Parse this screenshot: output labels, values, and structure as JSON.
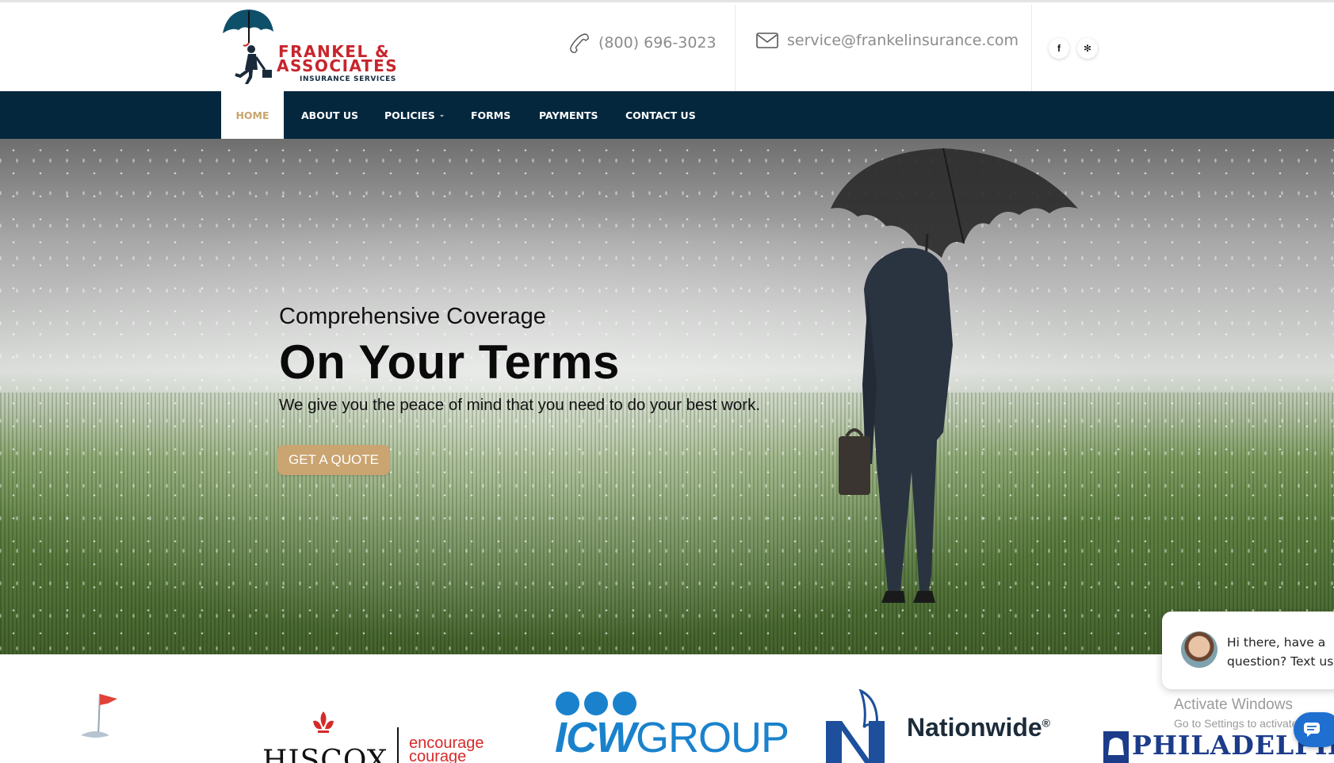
{
  "brand": {
    "name_line1": "FRANKEL &",
    "name_line2": "ASSOCIATES",
    "tagline": "INSURANCE SERVICES"
  },
  "header": {
    "phone": "(800) 696-3023",
    "email": "service@frankelinsurance.com",
    "social": {
      "facebook_glyph": "f",
      "yelp_glyph": "✻"
    }
  },
  "nav": {
    "items": [
      {
        "label": "HOME",
        "active": true
      },
      {
        "label": "ABOUT US"
      },
      {
        "label": "POLICIES",
        "caret": "⌄"
      },
      {
        "label": "FORMS"
      },
      {
        "label": "PAYMENTS"
      },
      {
        "label": "CONTACT US"
      }
    ]
  },
  "hero": {
    "subtitle": "Comprehensive Coverage",
    "title": "On Your Terms",
    "description": "We give you the peace of mind that you need to do your best work.",
    "cta_label": "GET A QUOTE"
  },
  "partners": {
    "hiscox": "HISCOX",
    "hiscox_tag1": "encourage",
    "hiscox_tag2": "courage",
    "icw_bold": "ICW",
    "icw_rest": "GROUP",
    "nationwide": "Nationwide",
    "nationwide_mark": "®",
    "philadelphia": "PHILADELPHIA"
  },
  "chat": {
    "message": "Hi there, have a question? Text us"
  },
  "os_overlay": {
    "line1": "Activate Windows",
    "line2": "Go to Settings to activate Windows."
  },
  "colors": {
    "navy": "#04273d",
    "gold": "#c9a46b",
    "brand_red": "#c8252c"
  }
}
